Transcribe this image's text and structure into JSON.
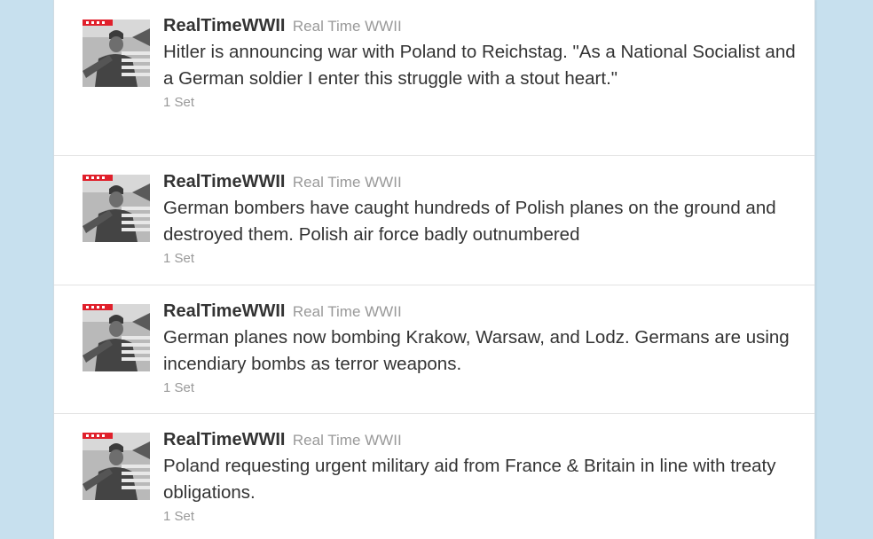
{
  "tweets": [
    {
      "screen_name": "RealTimeWWII",
      "full_name": "Real Time WWII",
      "text": "Hitler is announcing war with Poland to Reichstag. \"As a National Socialist and a German soldier I enter this struggle with a stout heart.\"",
      "timestamp": "1 Set"
    },
    {
      "screen_name": "RealTimeWWII",
      "full_name": "Real Time WWII",
      "text": "German bombers have caught hundreds of Polish planes on the ground and destroyed them. Polish air force badly outnumbered",
      "timestamp": "1 Set"
    },
    {
      "screen_name": "RealTimeWWII",
      "full_name": "Real Time WWII",
      "text": "German planes now bombing Krakow, Warsaw, and Lodz. Germans are using incendiary bombs as terror weapons.",
      "timestamp": "1 Set"
    },
    {
      "screen_name": "RealTimeWWII",
      "full_name": "Real Time WWII",
      "text": "Poland requesting urgent military aid from France & Britain in line with treaty obligations.",
      "timestamp": "1 Set"
    }
  ],
  "avatar": {
    "icon": "soldier-photo-icon",
    "badge_color": "#e0202b"
  },
  "colors": {
    "page_background": "#c7e0ee",
    "card_background": "#ffffff",
    "text": "#333333",
    "muted": "#999999"
  }
}
